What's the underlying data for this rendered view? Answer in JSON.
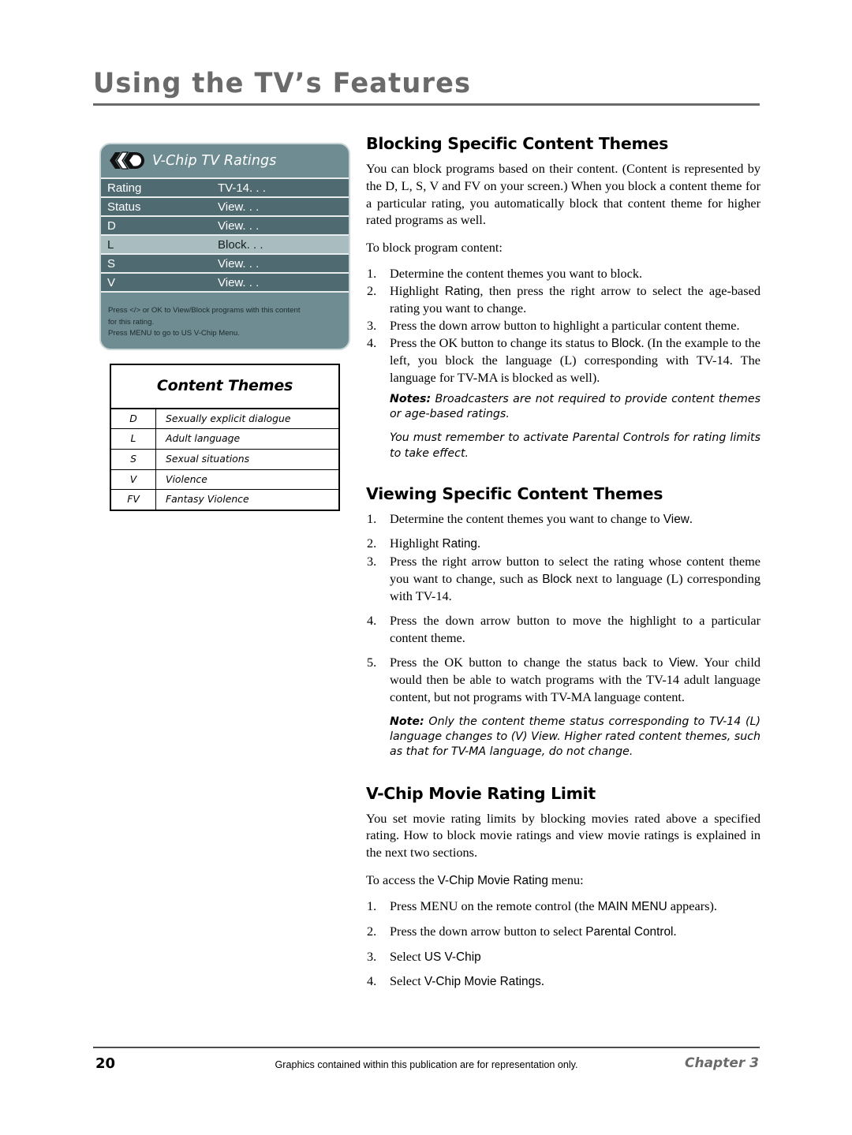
{
  "header": {
    "title": "Using the TV’s Features"
  },
  "vchip_panel": {
    "logo_icon": "vchip-logo-icon",
    "title": "V-Chip TV Ratings",
    "rows": [
      {
        "label": "Rating",
        "value": "TV-14. . .",
        "selected": false
      },
      {
        "label": "Status",
        "value": "View. . .",
        "selected": false
      },
      {
        "label": "D",
        "value": "View. . .",
        "selected": false
      },
      {
        "label": "L",
        "value": "Block. . .",
        "selected": true
      },
      {
        "label": "S",
        "value": "View. . .",
        "selected": false
      },
      {
        "label": "V",
        "value": "View. . .",
        "selected": false
      }
    ],
    "footnote_lines": [
      "Press </> or OK to View/Block programs with this content",
      "for this rating.",
      "Press MENU to go to US V-Chip Menu."
    ]
  },
  "content_themes": {
    "heading": "Content Themes",
    "rows": [
      {
        "code": "D",
        "description": "Sexually explicit dialogue"
      },
      {
        "code": "L",
        "description": "Adult language"
      },
      {
        "code": "S",
        "description": "Sexual situations"
      },
      {
        "code": "V",
        "description": "Violence"
      },
      {
        "code": "FV",
        "description": "Fantasy Violence"
      }
    ]
  },
  "sections": {
    "blocking": {
      "heading": "Blocking Specific Content Themes",
      "intro": "You can block programs based on their content. (Content is represented by the D, L, S, V and FV on your screen.) When you block a content theme for a particular rating, you automatically block that content theme for higher rated programs as well.",
      "lead_in": "To block program content:",
      "step1": "Determine the content themes you want to block.",
      "step2_a": "Highlight ",
      "step2_term": "Rating",
      "step2_b": ", then press the right arrow to select the age-based rating you want to change.",
      "step3": "Press the down arrow button to highlight a particular content theme.",
      "step4_a": "Press the OK button to change its status to ",
      "step4_term": "Block",
      "step4_b": ". (In the example to the left, you block the language (L) corresponding with TV-14. The language for TV-MA is blocked as well).",
      "note1_label": "Notes:",
      "note1_text": " Broadcasters are not required to provide content themes or age-based ratings.",
      "note2_text": "You must remember to activate Parental Controls for rating limits to take effect."
    },
    "viewing": {
      "heading": "Viewing Specific Content Themes",
      "step1_a": "Determine the content themes you want to change to ",
      "step1_term": "View",
      "step1_b": ".",
      "step2_a": "Highlight ",
      "step2_term": "Rating",
      "step2_b": ".",
      "step3_a": "Press the right arrow button to select the rating whose content theme you want to change, such as ",
      "step3_term": "Block",
      "step3_b": " next to language (L) corresponding with TV-14.",
      "step4": "Press the down arrow button to move the highlight to a particular content theme.",
      "step5_a": "Press the OK button to change the status back to ",
      "step5_term": "View",
      "step5_b": ".  Your child would then be able to watch programs with the TV-14 adult language content, but not programs with TV-MA language content.",
      "note_label": "Note:",
      "note_text": "  Only the content theme status corresponding to TV-14 (L) language changes to (V) View. Higher rated content themes, such as that for TV-MA language, do not change."
    },
    "movie_limit": {
      "heading": "V-Chip Movie Rating Limit",
      "intro": "You set movie rating limits by blocking movies rated above a specified rating. How to block movie ratings and view movie ratings is explained in the next two sections.",
      "lead_a": "To access the ",
      "lead_term": "V-Chip Movie Rating",
      "lead_b": " menu:",
      "step1_a": "Press MENU on the remote control (the ",
      "step1_term": "MAIN MENU",
      "step1_b": " appears).",
      "step2_a": "Press the down arrow button to select ",
      "step2_term": "Parental Control",
      "step2_b": ".",
      "step3_a": "Select ",
      "step3_term": "US V-Chip",
      "step3_b": "",
      "step4_a": "Select ",
      "step4_term": "V-Chip Movie Ratings",
      "step4_b": "."
    }
  },
  "footer": {
    "page_number": "20",
    "note": "Graphics contained within this publication are for representation only.",
    "chapter": "Chapter 3"
  }
}
